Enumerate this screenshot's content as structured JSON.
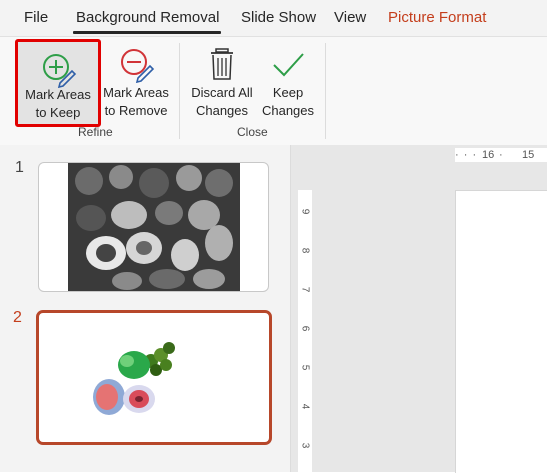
{
  "menu": {
    "tabs": [
      {
        "label": "File"
      },
      {
        "label": "Background Removal"
      },
      {
        "label": "Slide Show"
      },
      {
        "label": "View"
      },
      {
        "label": "Picture Format"
      }
    ]
  },
  "ribbon": {
    "refine": {
      "group_label": "Refine",
      "mark_keep": "Mark Areas\nto Keep",
      "mark_keep_l1": "Mark Areas",
      "mark_keep_l2": "to Keep",
      "mark_remove_l1": "Mark Areas",
      "mark_remove_l2": "to Remove"
    },
    "close": {
      "group_label": "Close",
      "discard_l1": "Discard All",
      "discard_l2": "Changes",
      "keep_l1": "Keep",
      "keep_l2": "Changes"
    }
  },
  "slides": [
    {
      "number": "1"
    },
    {
      "number": "2"
    }
  ],
  "ruler": {
    "h_ticks": [
      "16",
      "15"
    ],
    "v_ticks": [
      "9",
      "8",
      "7",
      "6",
      "5",
      "4",
      "3"
    ]
  },
  "colors": {
    "accent": "#c43e1c",
    "highlight": "#e10000"
  },
  "icons": {
    "keep": "plus-circle-pen-icon",
    "remove": "minus-circle-pen-icon",
    "discard": "trash-icon",
    "keep_changes": "checkmark-icon"
  }
}
